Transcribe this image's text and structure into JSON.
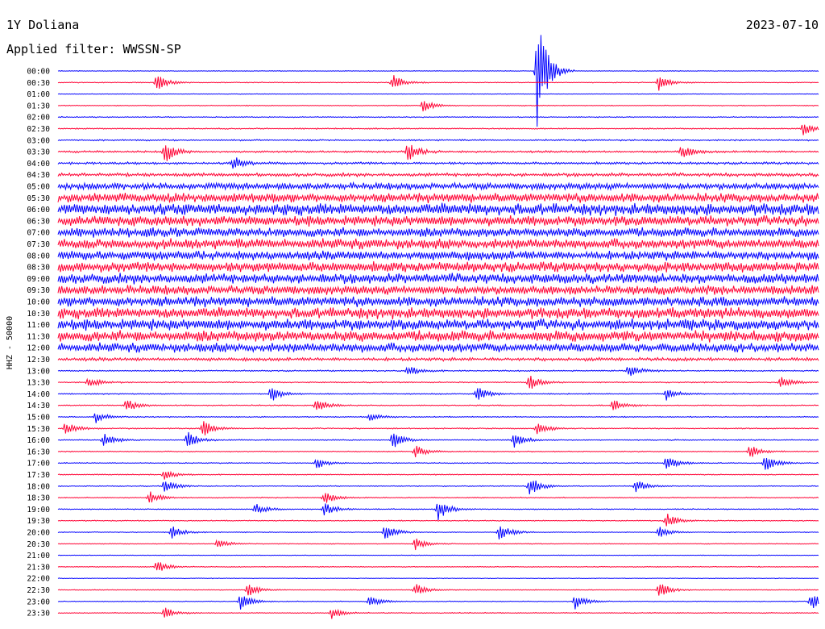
{
  "header": {
    "station": "1Y Doliana",
    "date": "2023-07-10",
    "filter": "Applied filter: WWSSN-SP"
  },
  "chart_data": {
    "type": "line",
    "title": "1Y Doliana",
    "subtitle": "Applied filter: WWSSN-SP",
    "date": "2023-07-10",
    "ylabel": "HHZ - 50000",
    "channel": "HHZ",
    "gain": 50000,
    "row_labels": [
      "00:00",
      "00:30",
      "01:00",
      "01:30",
      "02:00",
      "02:30",
      "03:00",
      "03:30",
      "04:00",
      "04:30",
      "05:00",
      "05:30",
      "06:00",
      "06:30",
      "07:00",
      "07:30",
      "08:00",
      "08:30",
      "09:00",
      "09:30",
      "10:00",
      "10:30",
      "11:00",
      "11:30",
      "12:00",
      "12:30",
      "13:00",
      "13:30",
      "14:00",
      "14:30",
      "15:00",
      "15:30",
      "16:00",
      "16:30",
      "17:00",
      "17:30",
      "18:00",
      "18:30",
      "19:00",
      "19:30",
      "20:00",
      "20:30",
      "21:00",
      "21:30",
      "22:00",
      "22:30",
      "23:00",
      "23:30"
    ],
    "series_colors": [
      "#0000ff",
      "#ff0033"
    ],
    "row_noise_level": [
      0.04,
      0.05,
      0.04,
      0.05,
      0.06,
      0.07,
      0.09,
      0.12,
      0.14,
      0.2,
      0.4,
      0.55,
      0.7,
      0.6,
      0.55,
      0.6,
      0.55,
      0.6,
      0.6,
      0.55,
      0.6,
      0.65,
      0.65,
      0.65,
      0.55,
      0.2,
      0.08,
      0.07,
      0.07,
      0.07,
      0.06,
      0.07,
      0.07,
      0.06,
      0.06,
      0.06,
      0.06,
      0.06,
      0.06,
      0.06,
      0.05,
      0.05,
      0.04,
      0.05,
      0.04,
      0.05,
      0.05,
      0.05
    ],
    "events": [
      {
        "row": 0,
        "t": 0.63,
        "amp": 6.0
      },
      {
        "row": 1,
        "t": 0.13,
        "amp": 0.9
      },
      {
        "row": 1,
        "t": 0.44,
        "amp": 0.9
      },
      {
        "row": 1,
        "t": 0.79,
        "amp": 0.8
      },
      {
        "row": 3,
        "t": 0.48,
        "amp": 0.7
      },
      {
        "row": 5,
        "t": 0.98,
        "amp": 0.7
      },
      {
        "row": 7,
        "t": 0.14,
        "amp": 1.2
      },
      {
        "row": 7,
        "t": 0.46,
        "amp": 1.0
      },
      {
        "row": 7,
        "t": 0.82,
        "amp": 0.7
      },
      {
        "row": 8,
        "t": 0.23,
        "amp": 0.8
      },
      {
        "row": 26,
        "t": 0.46,
        "amp": 0.6
      },
      {
        "row": 26,
        "t": 0.75,
        "amp": 0.7
      },
      {
        "row": 27,
        "t": 0.04,
        "amp": 0.6
      },
      {
        "row": 27,
        "t": 0.62,
        "amp": 0.8
      },
      {
        "row": 27,
        "t": 0.95,
        "amp": 0.7
      },
      {
        "row": 28,
        "t": 0.28,
        "amp": 0.9
      },
      {
        "row": 28,
        "t": 0.55,
        "amp": 0.8
      },
      {
        "row": 28,
        "t": 0.8,
        "amp": 0.7
      },
      {
        "row": 29,
        "t": 0.09,
        "amp": 0.7
      },
      {
        "row": 29,
        "t": 0.34,
        "amp": 0.8
      },
      {
        "row": 29,
        "t": 0.73,
        "amp": 0.6
      },
      {
        "row": 30,
        "t": 0.05,
        "amp": 0.6
      },
      {
        "row": 30,
        "t": 0.41,
        "amp": 0.5
      },
      {
        "row": 31,
        "t": 0.01,
        "amp": 0.7
      },
      {
        "row": 31,
        "t": 0.19,
        "amp": 0.9
      },
      {
        "row": 31,
        "t": 0.63,
        "amp": 0.7
      },
      {
        "row": 32,
        "t": 0.06,
        "amp": 0.8
      },
      {
        "row": 32,
        "t": 0.17,
        "amp": 0.9
      },
      {
        "row": 32,
        "t": 0.44,
        "amp": 0.9
      },
      {
        "row": 32,
        "t": 0.6,
        "amp": 0.8
      },
      {
        "row": 33,
        "t": 0.47,
        "amp": 0.7
      },
      {
        "row": 33,
        "t": 0.91,
        "amp": 0.7
      },
      {
        "row": 34,
        "t": 0.34,
        "amp": 0.6
      },
      {
        "row": 34,
        "t": 0.8,
        "amp": 0.8
      },
      {
        "row": 34,
        "t": 0.93,
        "amp": 0.9
      },
      {
        "row": 35,
        "t": 0.14,
        "amp": 0.6
      },
      {
        "row": 36,
        "t": 0.14,
        "amp": 0.8
      },
      {
        "row": 36,
        "t": 0.62,
        "amp": 1.1
      },
      {
        "row": 36,
        "t": 0.76,
        "amp": 0.7
      },
      {
        "row": 37,
        "t": 0.12,
        "amp": 0.7
      },
      {
        "row": 37,
        "t": 0.35,
        "amp": 0.7
      },
      {
        "row": 38,
        "t": 0.26,
        "amp": 0.6
      },
      {
        "row": 38,
        "t": 0.35,
        "amp": 0.8
      },
      {
        "row": 38,
        "t": 0.5,
        "amp": 1.2
      },
      {
        "row": 39,
        "t": 0.8,
        "amp": 0.8
      },
      {
        "row": 40,
        "t": 0.15,
        "amp": 0.7
      },
      {
        "row": 40,
        "t": 0.43,
        "amp": 0.9
      },
      {
        "row": 40,
        "t": 0.58,
        "amp": 1.0
      },
      {
        "row": 40,
        "t": 0.79,
        "amp": 0.6
      },
      {
        "row": 41,
        "t": 0.21,
        "amp": 0.6
      },
      {
        "row": 41,
        "t": 0.47,
        "amp": 0.6
      },
      {
        "row": 43,
        "t": 0.13,
        "amp": 0.7
      },
      {
        "row": 45,
        "t": 0.25,
        "amp": 0.7
      },
      {
        "row": 45,
        "t": 0.47,
        "amp": 0.7
      },
      {
        "row": 45,
        "t": 0.79,
        "amp": 0.9
      },
      {
        "row": 46,
        "t": 0.24,
        "amp": 0.9
      },
      {
        "row": 46,
        "t": 0.41,
        "amp": 0.7
      },
      {
        "row": 46,
        "t": 0.68,
        "amp": 0.8
      },
      {
        "row": 46,
        "t": 0.99,
        "amp": 0.9
      },
      {
        "row": 47,
        "t": 0.14,
        "amp": 0.6
      },
      {
        "row": 47,
        "t": 0.36,
        "amp": 0.6
      }
    ]
  }
}
